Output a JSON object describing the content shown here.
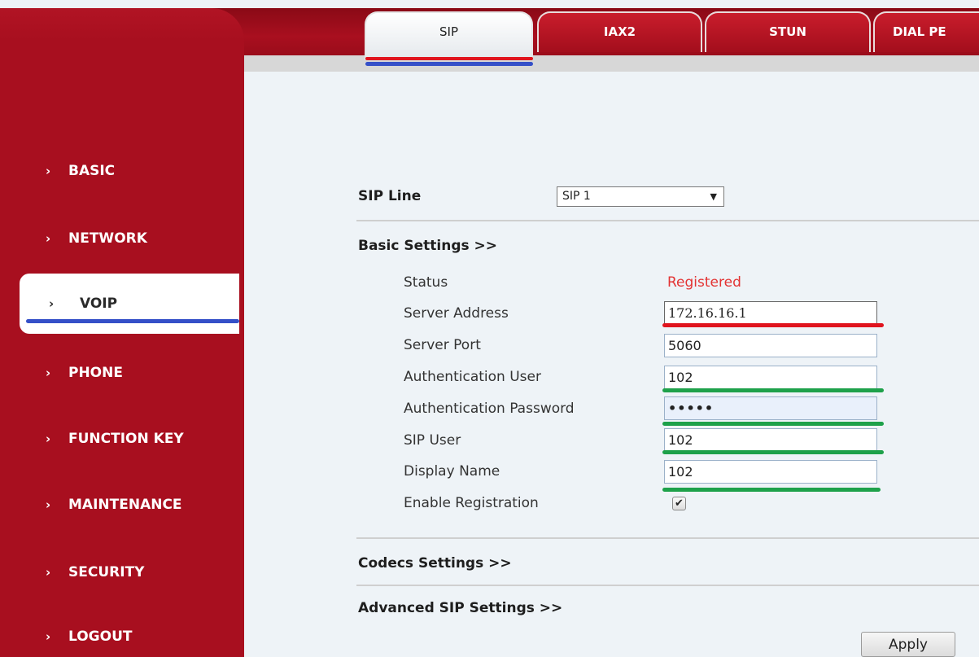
{
  "tabs": [
    {
      "label": "SIP",
      "active": true
    },
    {
      "label": "IAX2",
      "active": false
    },
    {
      "label": "STUN",
      "active": false
    },
    {
      "label": "DIAL PE",
      "active": false
    }
  ],
  "sidebar": {
    "items": [
      {
        "label": "BASIC"
      },
      {
        "label": "NETWORK"
      },
      {
        "label": "VOIP",
        "active": true
      },
      {
        "label": "PHONE"
      },
      {
        "label": "FUNCTION KEY"
      },
      {
        "label": "MAINTENANCE"
      },
      {
        "label": "SECURITY"
      },
      {
        "label": "LOGOUT"
      }
    ],
    "chevron": "›"
  },
  "sip_line": {
    "label": "SIP Line",
    "selected": "SIP 1",
    "arrow": "▼"
  },
  "sections": {
    "basic": "Basic Settings >>",
    "codecs": "Codecs Settings >>",
    "advanced": "Advanced SIP Settings >>"
  },
  "basic_settings": {
    "status_label": "Status",
    "status_value": "Registered",
    "server_address_label": "Server Address",
    "server_address_value": "172.16.16.1",
    "server_port_label": "Server Port",
    "server_port_value": "5060",
    "auth_user_label": "Authentication User",
    "auth_user_value": "102",
    "auth_password_label": "Authentication Password",
    "auth_password_value": "•••••",
    "sip_user_label": "SIP User",
    "sip_user_value": "102",
    "display_name_label": "Display Name",
    "display_name_value": "102",
    "enable_registration_label": "Enable Registration",
    "enable_registration_checked": true,
    "check_glyph": "✔"
  },
  "apply_label": "Apply",
  "colors": {
    "brand_red": "#a80f1f",
    "status_red": "#e33434",
    "annotation_red": "#e0141e",
    "annotation_blue": "#3550c8",
    "annotation_green": "#1ea14a"
  }
}
